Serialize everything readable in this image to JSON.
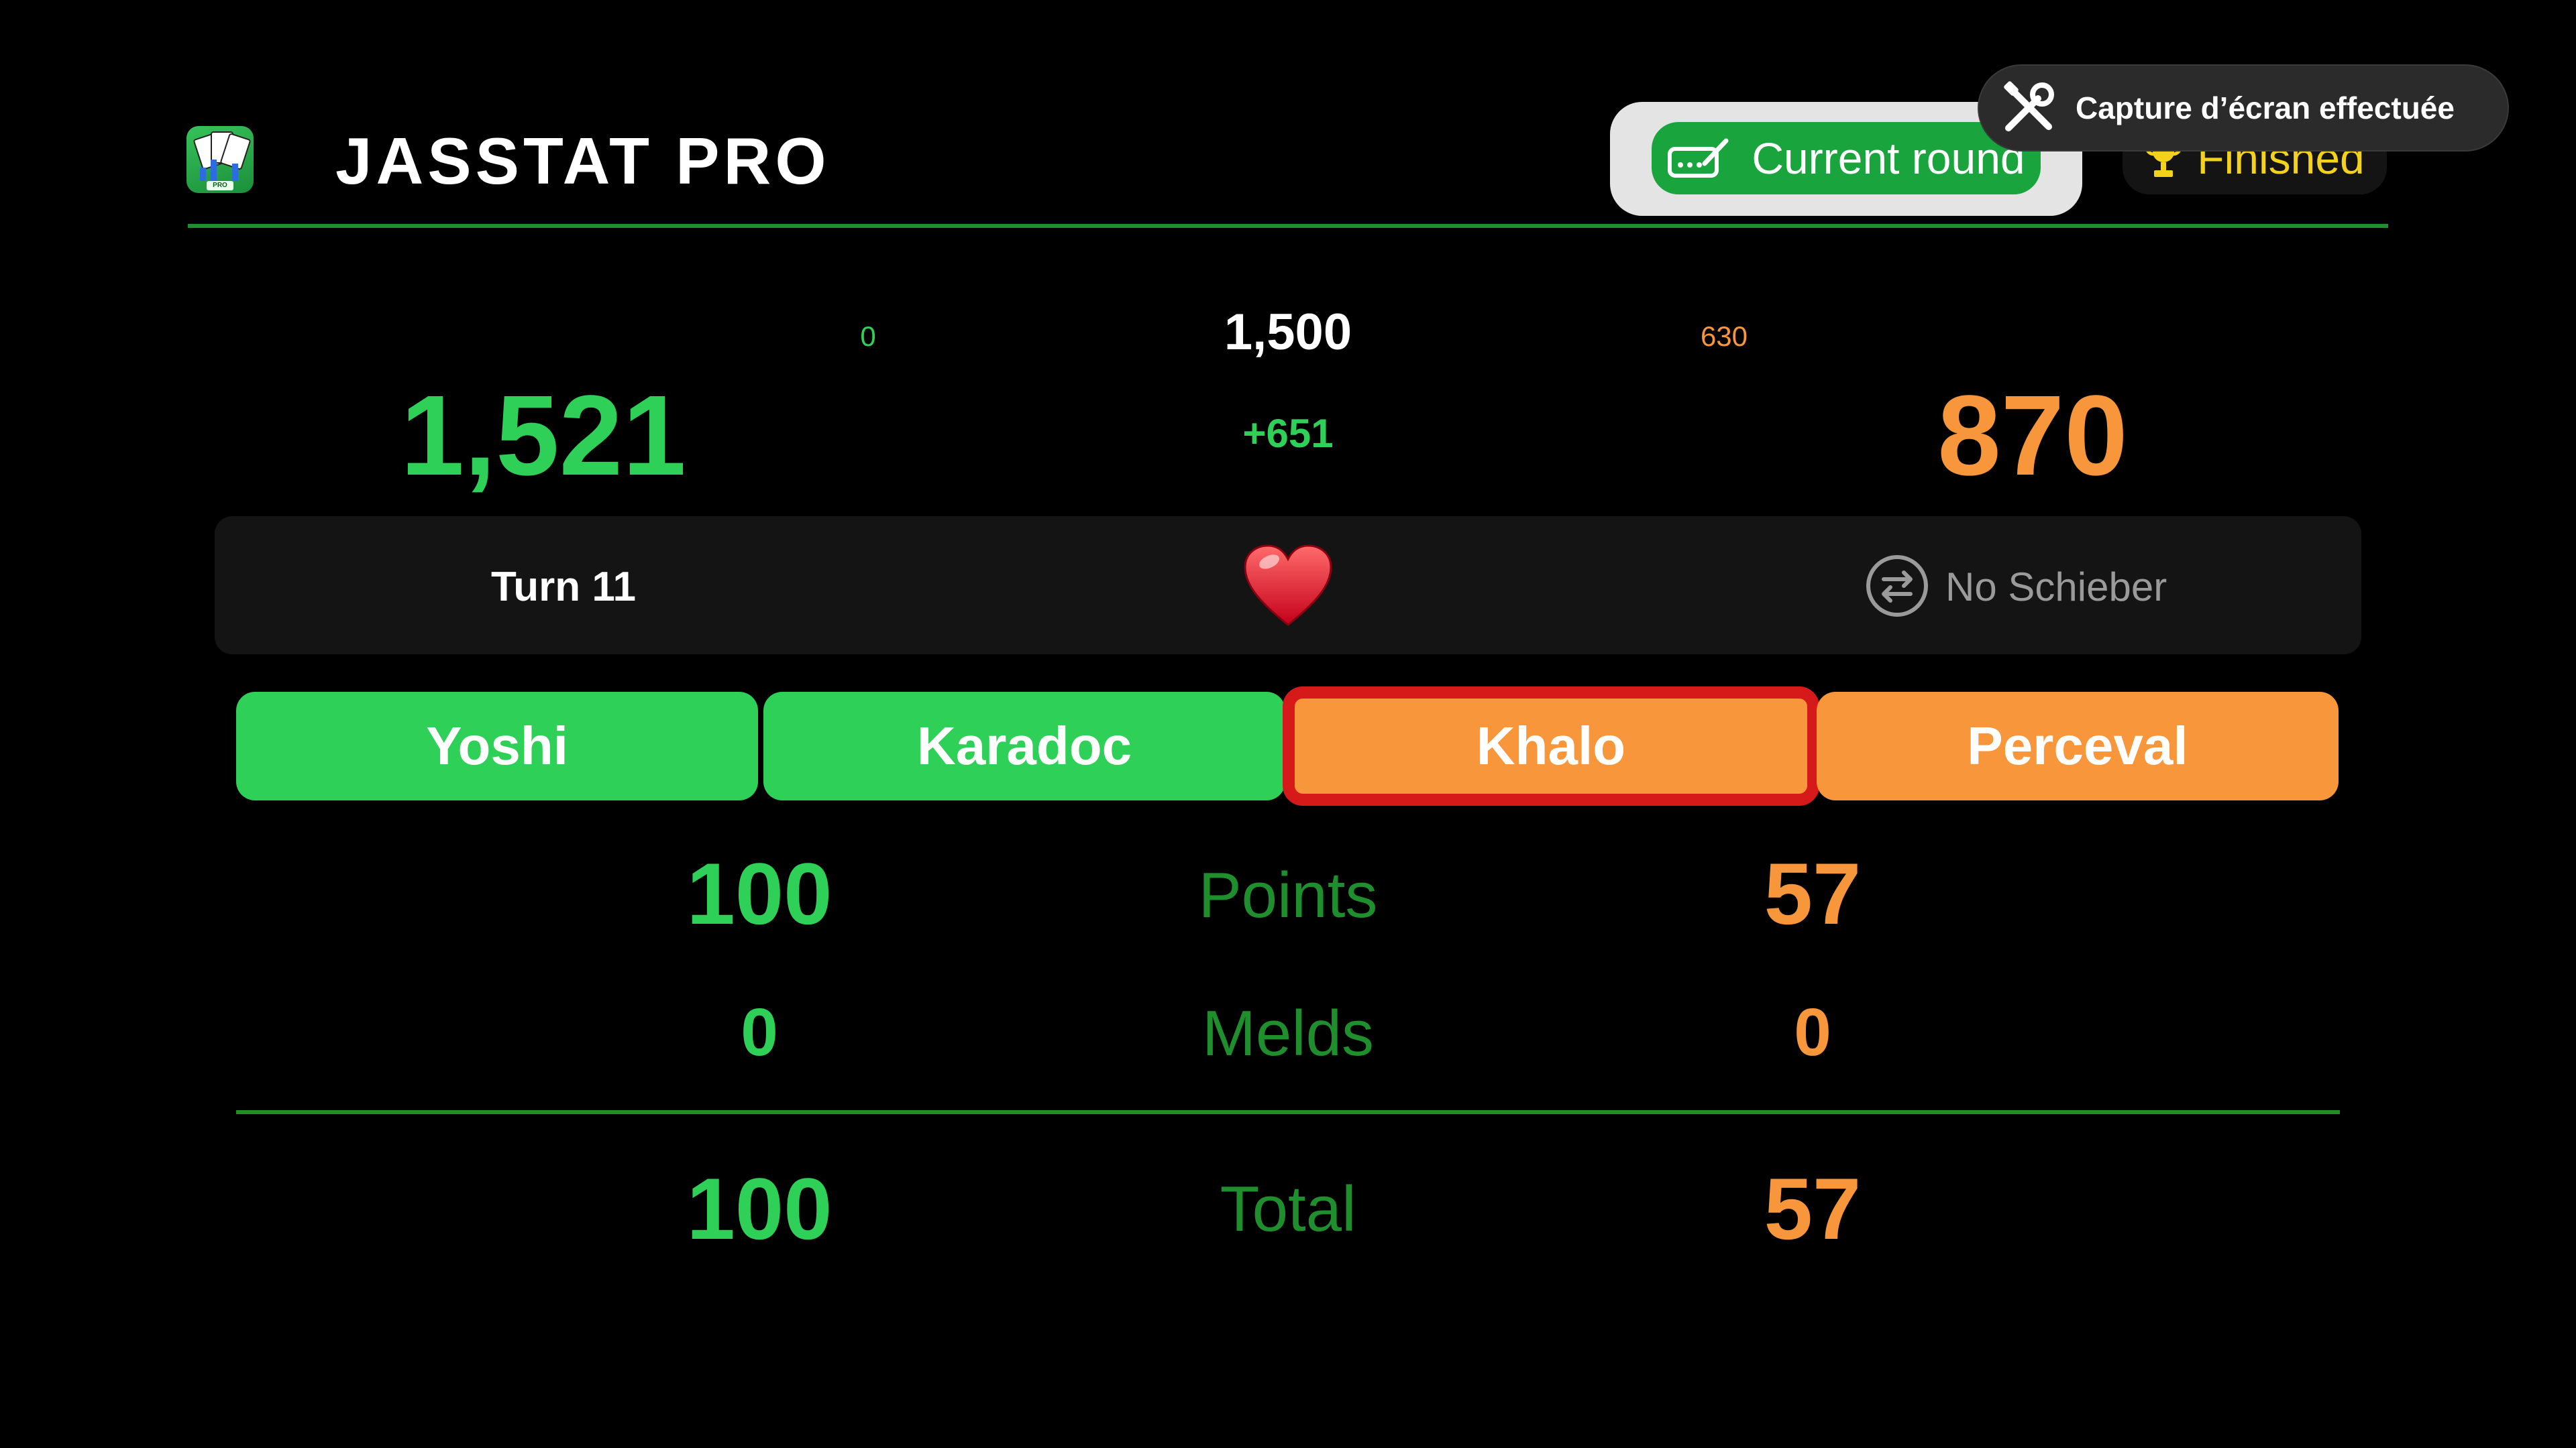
{
  "header": {
    "app_title": "JASSTAT PRO",
    "icon_tag": "PRO"
  },
  "tabs": [
    {
      "label": "Current round",
      "icon": "scorepad-pen-icon",
      "selected": true
    },
    {
      "label": "Finished",
      "icon": "trophy-icon",
      "selected": false
    }
  ],
  "notification": {
    "text": "Capture d’écran effectuée",
    "icon": "tools-icon"
  },
  "scores": {
    "left_total": "1,521",
    "right_total": "870",
    "left_remaining": "0",
    "right_remaining": "630",
    "target": "1,500",
    "lead": "+651"
  },
  "round_info": {
    "turn": "Turn 11",
    "trump_icon": "heart-icon",
    "schieber_label": "No Schieber"
  },
  "players": [
    {
      "name": "Yoshi",
      "team": "green"
    },
    {
      "name": "Karadoc",
      "team": "green"
    },
    {
      "name": "Khalo",
      "team": "orange",
      "selected": true
    },
    {
      "name": "Perceval",
      "team": "orange"
    }
  ],
  "rows": {
    "points": {
      "label": "Points",
      "left": "100",
      "right": "57"
    },
    "melds": {
      "label": "Melds",
      "left": "0",
      "right": "0"
    },
    "total": {
      "label": "Total",
      "left": "100",
      "right": "57"
    }
  },
  "colors": {
    "team_green": "#2fd058",
    "team_orange": "#f7963a",
    "accent_green": "#1f8f2e",
    "selection_red": "#d61a1a",
    "finished_yellow": "#f4d21c"
  }
}
